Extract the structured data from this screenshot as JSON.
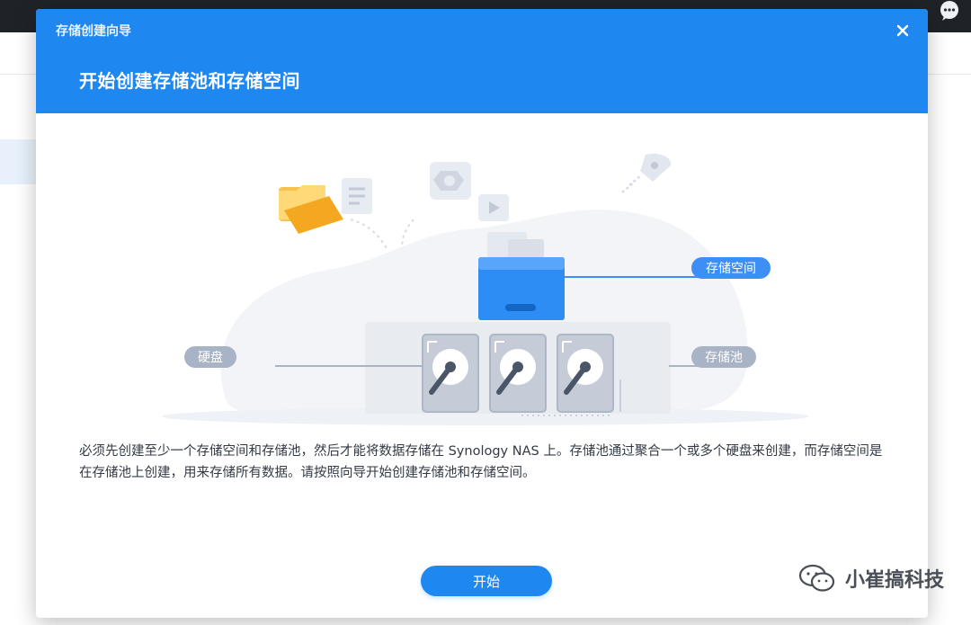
{
  "dialog": {
    "window_title": "存储创建向导",
    "heading": "开始创建存储池和存储空间",
    "description": "必须先创建至少一个存储空间和存储池，然后才能将数据存储在 Synology NAS 上。存储池通过聚合一个或多个硬盘来创建，而存储空间是在存储池上创建，用来存储所有数据。请按照向导开始创建存储池和存储空间。",
    "start_button": "开始"
  },
  "illustration": {
    "label_space": "存储空间",
    "label_pool": "存储池",
    "label_disk": "硬盘"
  },
  "icons": {
    "close": "close-icon",
    "chat": "chat-icon",
    "wechat": "wechat-icon"
  },
  "colors": {
    "header_blue": "#1e87f0",
    "pill_blue": "#3d8ff6",
    "pill_gray": "#a9b3c6"
  },
  "watermark": {
    "text": "小崔搞科技"
  }
}
